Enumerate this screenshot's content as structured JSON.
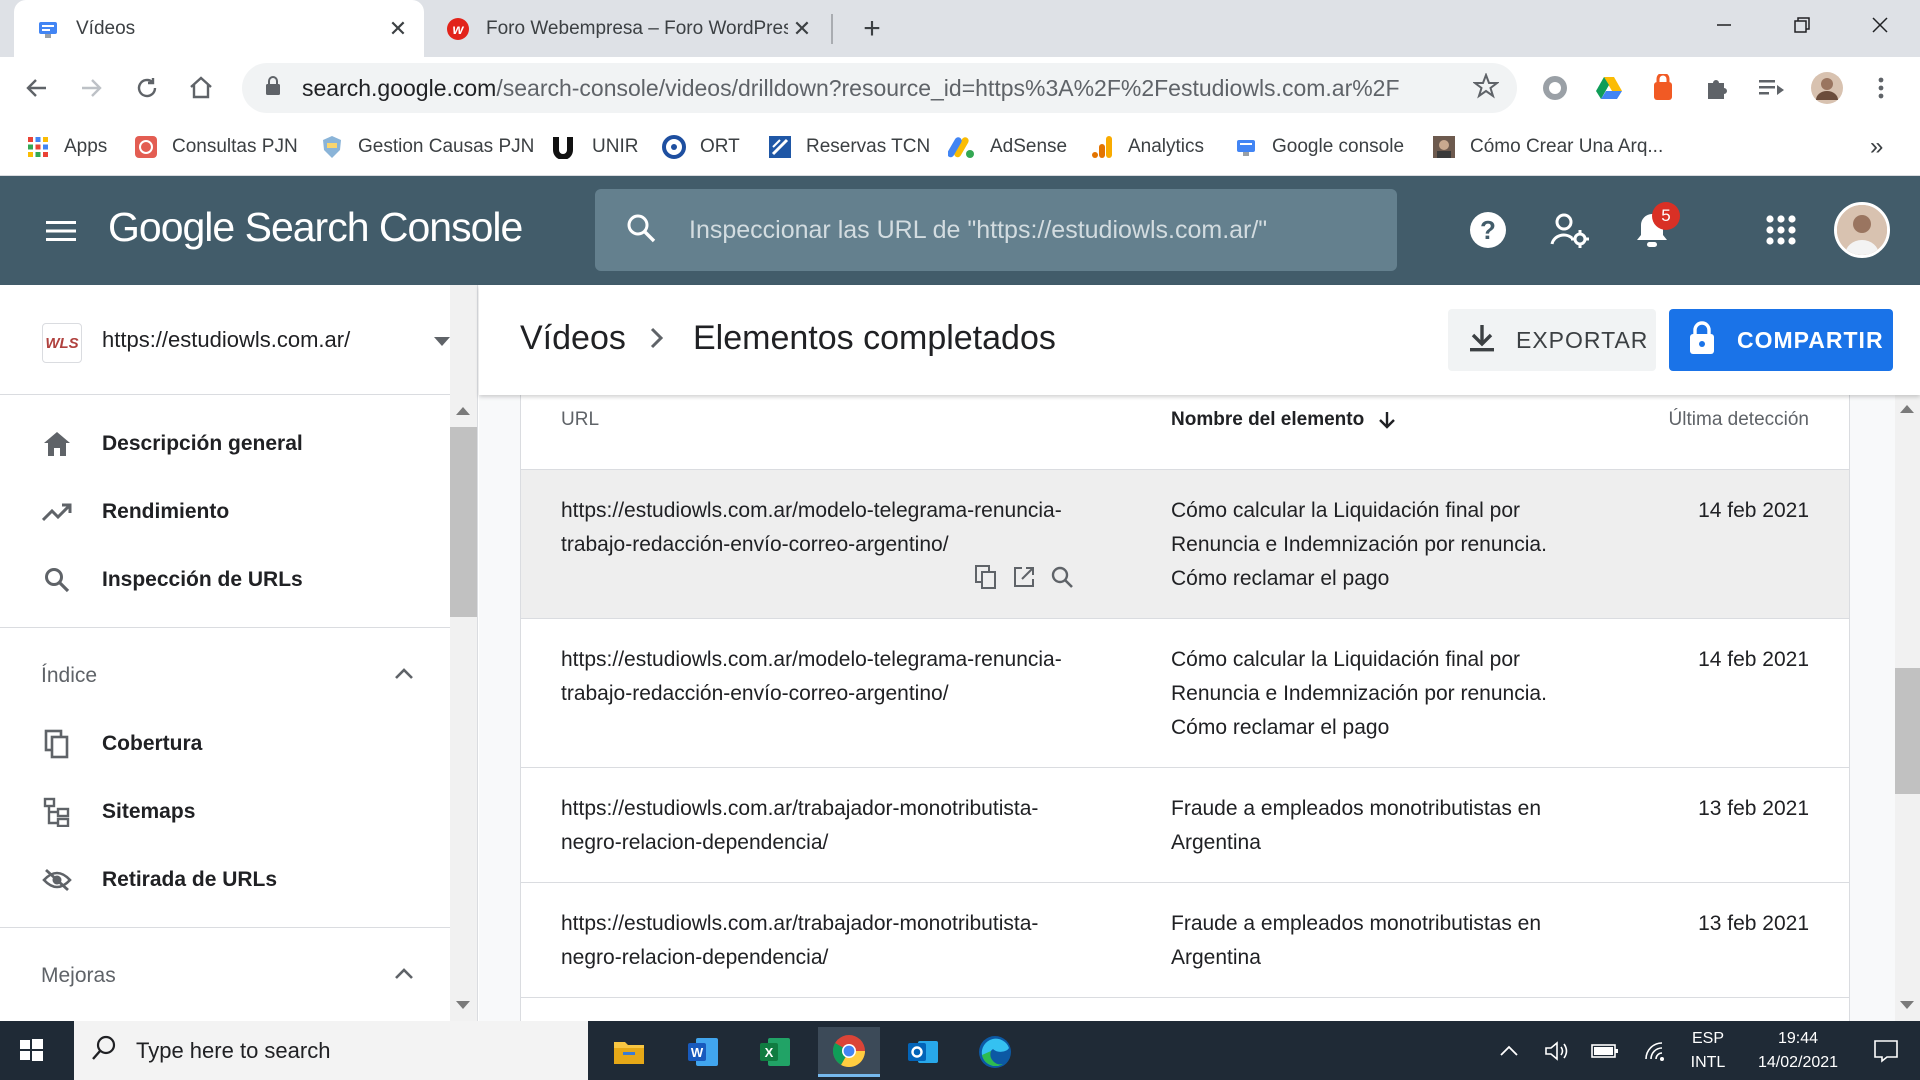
{
  "browser": {
    "tabs": [
      {
        "title": "Vídeos",
        "active": true
      },
      {
        "title": "Foro Webempresa – Foro WordPress",
        "active": false
      }
    ],
    "url_host": "search.google.com",
    "url_path": "/search-console/videos/drilldown?resource_id=https%3A%2F%2Festudiowls.com.ar%2F",
    "bookmarks": [
      {
        "label": "Apps",
        "icon": "apps-grid-icon"
      },
      {
        "label": "Consultas PJN",
        "icon": "pjn-icon"
      },
      {
        "label": "Gestion Causas PJN",
        "icon": "pjn-shield-icon"
      },
      {
        "label": "UNIR",
        "icon": "unir-icon"
      },
      {
        "label": "ORT",
        "icon": "ort-icon"
      },
      {
        "label": "Reservas TCN",
        "icon": "tcn-icon"
      },
      {
        "label": "AdSense",
        "icon": "adsense-icon"
      },
      {
        "label": "Analytics",
        "icon": "analytics-icon"
      },
      {
        "label": "Google console",
        "icon": "google-console-icon"
      },
      {
        "label": "Cómo Crear Una Arq...",
        "icon": "video-thumb-icon"
      }
    ],
    "bookmarks_overflow": "»"
  },
  "gsc": {
    "logo": "Google Search Console",
    "search_placeholder": "Inspeccionar las URL de \"https://estudiowls.com.ar/\"",
    "notification_count": "5",
    "brand_color": "#425c6a",
    "accent_color": "#1a73e8"
  },
  "sidebar": {
    "property_icon_text": "WLS",
    "property": "https://estudiowls.com.ar/",
    "items": [
      {
        "label": "Descripción general",
        "icon": "home-icon"
      },
      {
        "label": "Rendimiento",
        "icon": "trending-up-icon"
      },
      {
        "label": "Inspección de URLs",
        "icon": "search-icon"
      }
    ],
    "sections": [
      {
        "label": "Índice",
        "items": [
          {
            "label": "Cobertura",
            "icon": "coverage-icon"
          },
          {
            "label": "Sitemaps",
            "icon": "sitemaps-icon"
          },
          {
            "label": "Retirada de URLs",
            "icon": "removals-icon"
          }
        ]
      },
      {
        "label": "Mejoras",
        "items": []
      }
    ]
  },
  "main": {
    "breadcrumb_parent": "Vídeos",
    "title": "Elementos completados",
    "export_label": "EXPORTAR",
    "share_label": "COMPARTIR",
    "columns": [
      "URL",
      "Nombre del elemento",
      "Última detección"
    ],
    "rows": [
      {
        "url": "https://estudiowls.com.ar/modelo-telegrama-renuncia-trabajo-redacción-envío-correo-argentino/",
        "name": "Cómo calcular la Liquidación final por Renuncia e Indemnización por renuncia. Cómo reclamar el pago",
        "date": "14 feb 2021"
      },
      {
        "url": "https://estudiowls.com.ar/modelo-telegrama-renuncia-trabajo-redacción-envío-correo-argentino/",
        "name": "Cómo calcular la Liquidación final por Renuncia e Indemnización por renuncia. Cómo reclamar el pago",
        "date": "14 feb 2021"
      },
      {
        "url": "https://estudiowls.com.ar/trabajador-monotributista-negro-relacion-dependencia/",
        "name": "Fraude a empleados monotributistas en Argentina",
        "date": "13 feb 2021"
      },
      {
        "url": "https://estudiowls.com.ar/trabajador-monotributista-negro-relacion-dependencia/",
        "name": "Fraude a empleados monotributistas en Argentina",
        "date": "13 feb 2021"
      }
    ]
  },
  "taskbar": {
    "search_placeholder": "Type here to search",
    "apps": [
      "file-explorer-icon",
      "word-icon",
      "excel-icon",
      "chrome-icon",
      "outlook-icon",
      "edge-icon"
    ],
    "lang_top": "ESP",
    "lang_bottom": "INTL",
    "time": "19:44",
    "date": "14/02/2021"
  }
}
